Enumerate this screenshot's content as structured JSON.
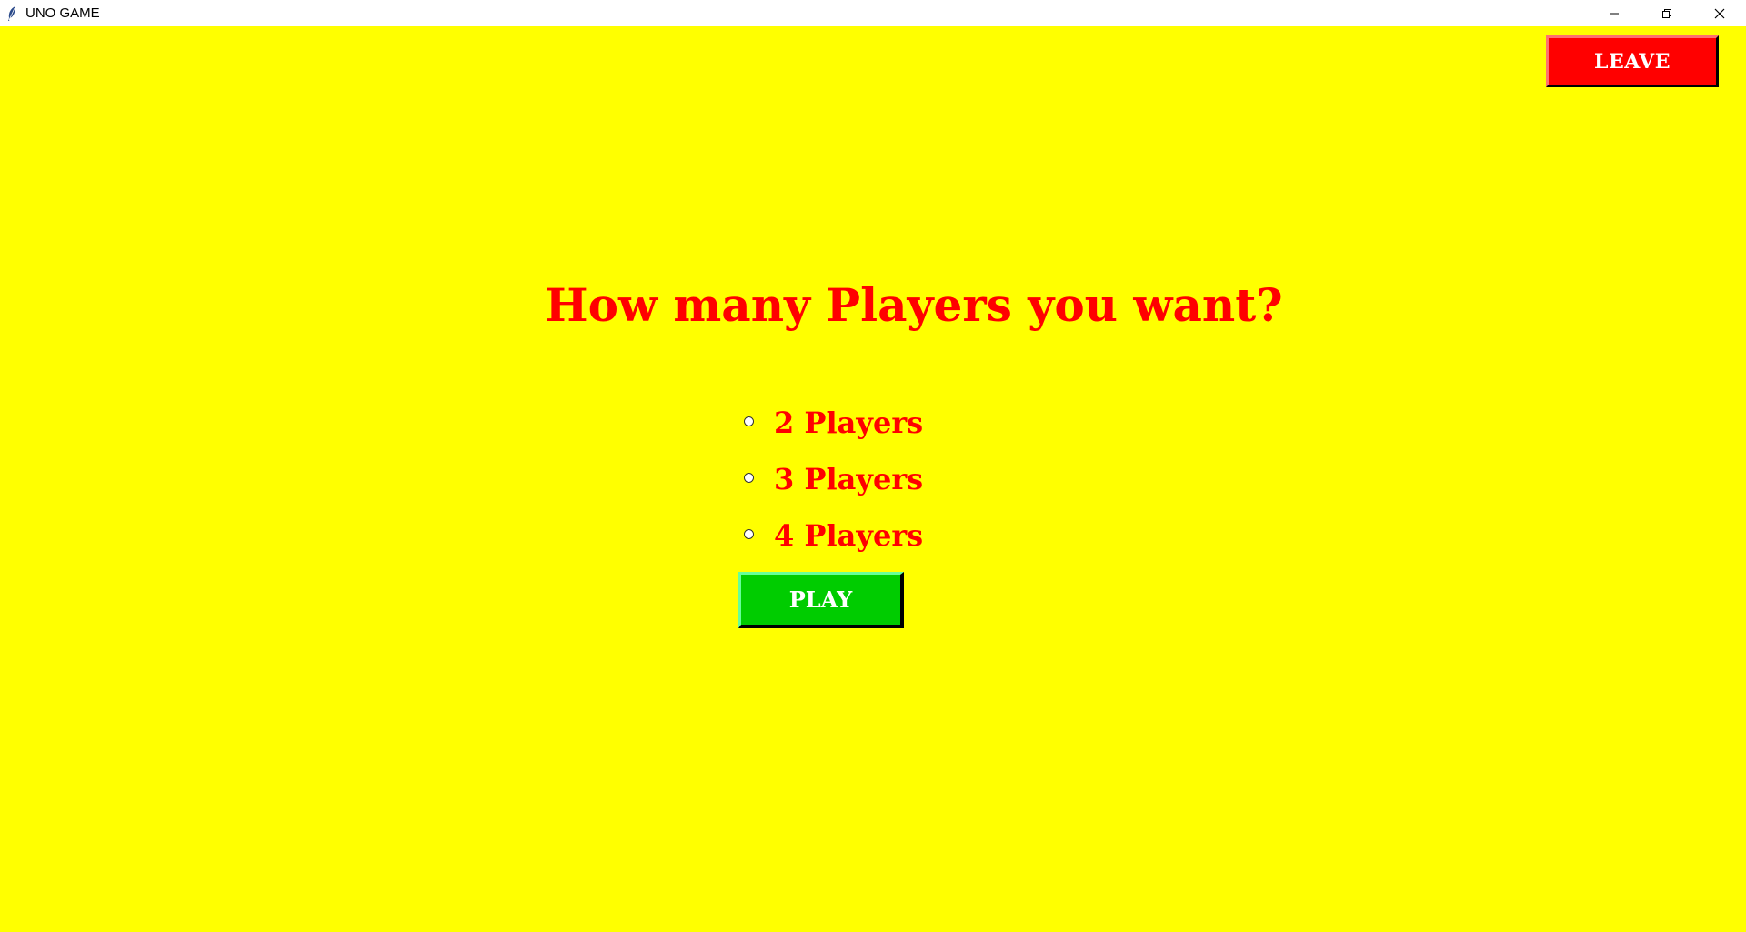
{
  "window": {
    "title": "UNO GAME",
    "app_icon": "feather-icon",
    "controls": [
      "minimize-icon",
      "restore-icon",
      "close-icon"
    ]
  },
  "toolbar": {
    "leave_label": "LEAVE"
  },
  "main": {
    "question": "How many Players you want?",
    "options": [
      {
        "label": "2 Players",
        "selected": false
      },
      {
        "label": "3 Players",
        "selected": false
      },
      {
        "label": "4 Players",
        "selected": false
      }
    ],
    "play_label": "PLAY"
  },
  "colors": {
    "background": "#ffff00",
    "text_accent": "#ff0000",
    "leave_button": "#ff0000",
    "play_button": "#00cc00"
  }
}
